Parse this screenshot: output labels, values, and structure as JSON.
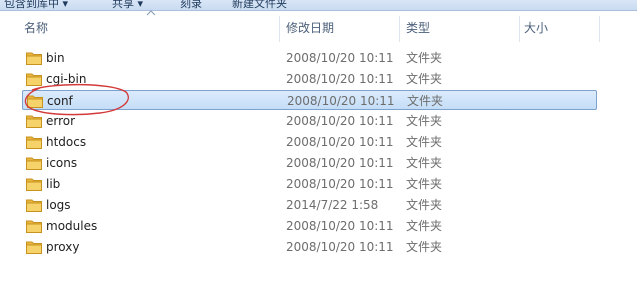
{
  "toolbar": {
    "items": [
      "包含到库中 ▾",
      "共享 ▾",
      "刻录",
      "新建文件夹"
    ]
  },
  "columns": {
    "name": "名称",
    "modified": "修改日期",
    "type": "类型",
    "size": "大小"
  },
  "rows": [
    {
      "name": "bin",
      "modified": "2008/10/20 10:11",
      "type": "文件夹"
    },
    {
      "name": "cgi-bin",
      "modified": "2008/10/20 10:11",
      "type": "文件夹"
    },
    {
      "name": "conf",
      "modified": "2008/10/20 10:11",
      "type": "文件夹",
      "selected": true
    },
    {
      "name": "error",
      "modified": "2008/10/20 10:11",
      "type": "文件夹"
    },
    {
      "name": "htdocs",
      "modified": "2008/10/20 10:11",
      "type": "文件夹"
    },
    {
      "name": "icons",
      "modified": "2008/10/20 10:11",
      "type": "文件夹"
    },
    {
      "name": "lib",
      "modified": "2008/10/20 10:11",
      "type": "文件夹"
    },
    {
      "name": "logs",
      "modified": "2014/7/22 1:58",
      "type": "文件夹"
    },
    {
      "name": "modules",
      "modified": "2008/10/20 10:11",
      "type": "文件夹"
    },
    {
      "name": "proxy",
      "modified": "2008/10/20 10:11",
      "type": "文件夹"
    }
  ],
  "icons": {
    "folder": "folder-icon",
    "sort": "sort-up-icon"
  },
  "colors": {
    "selection": "#c4ddf7",
    "selection_border": "#7da2ce",
    "annotation": "#d23a3a"
  }
}
